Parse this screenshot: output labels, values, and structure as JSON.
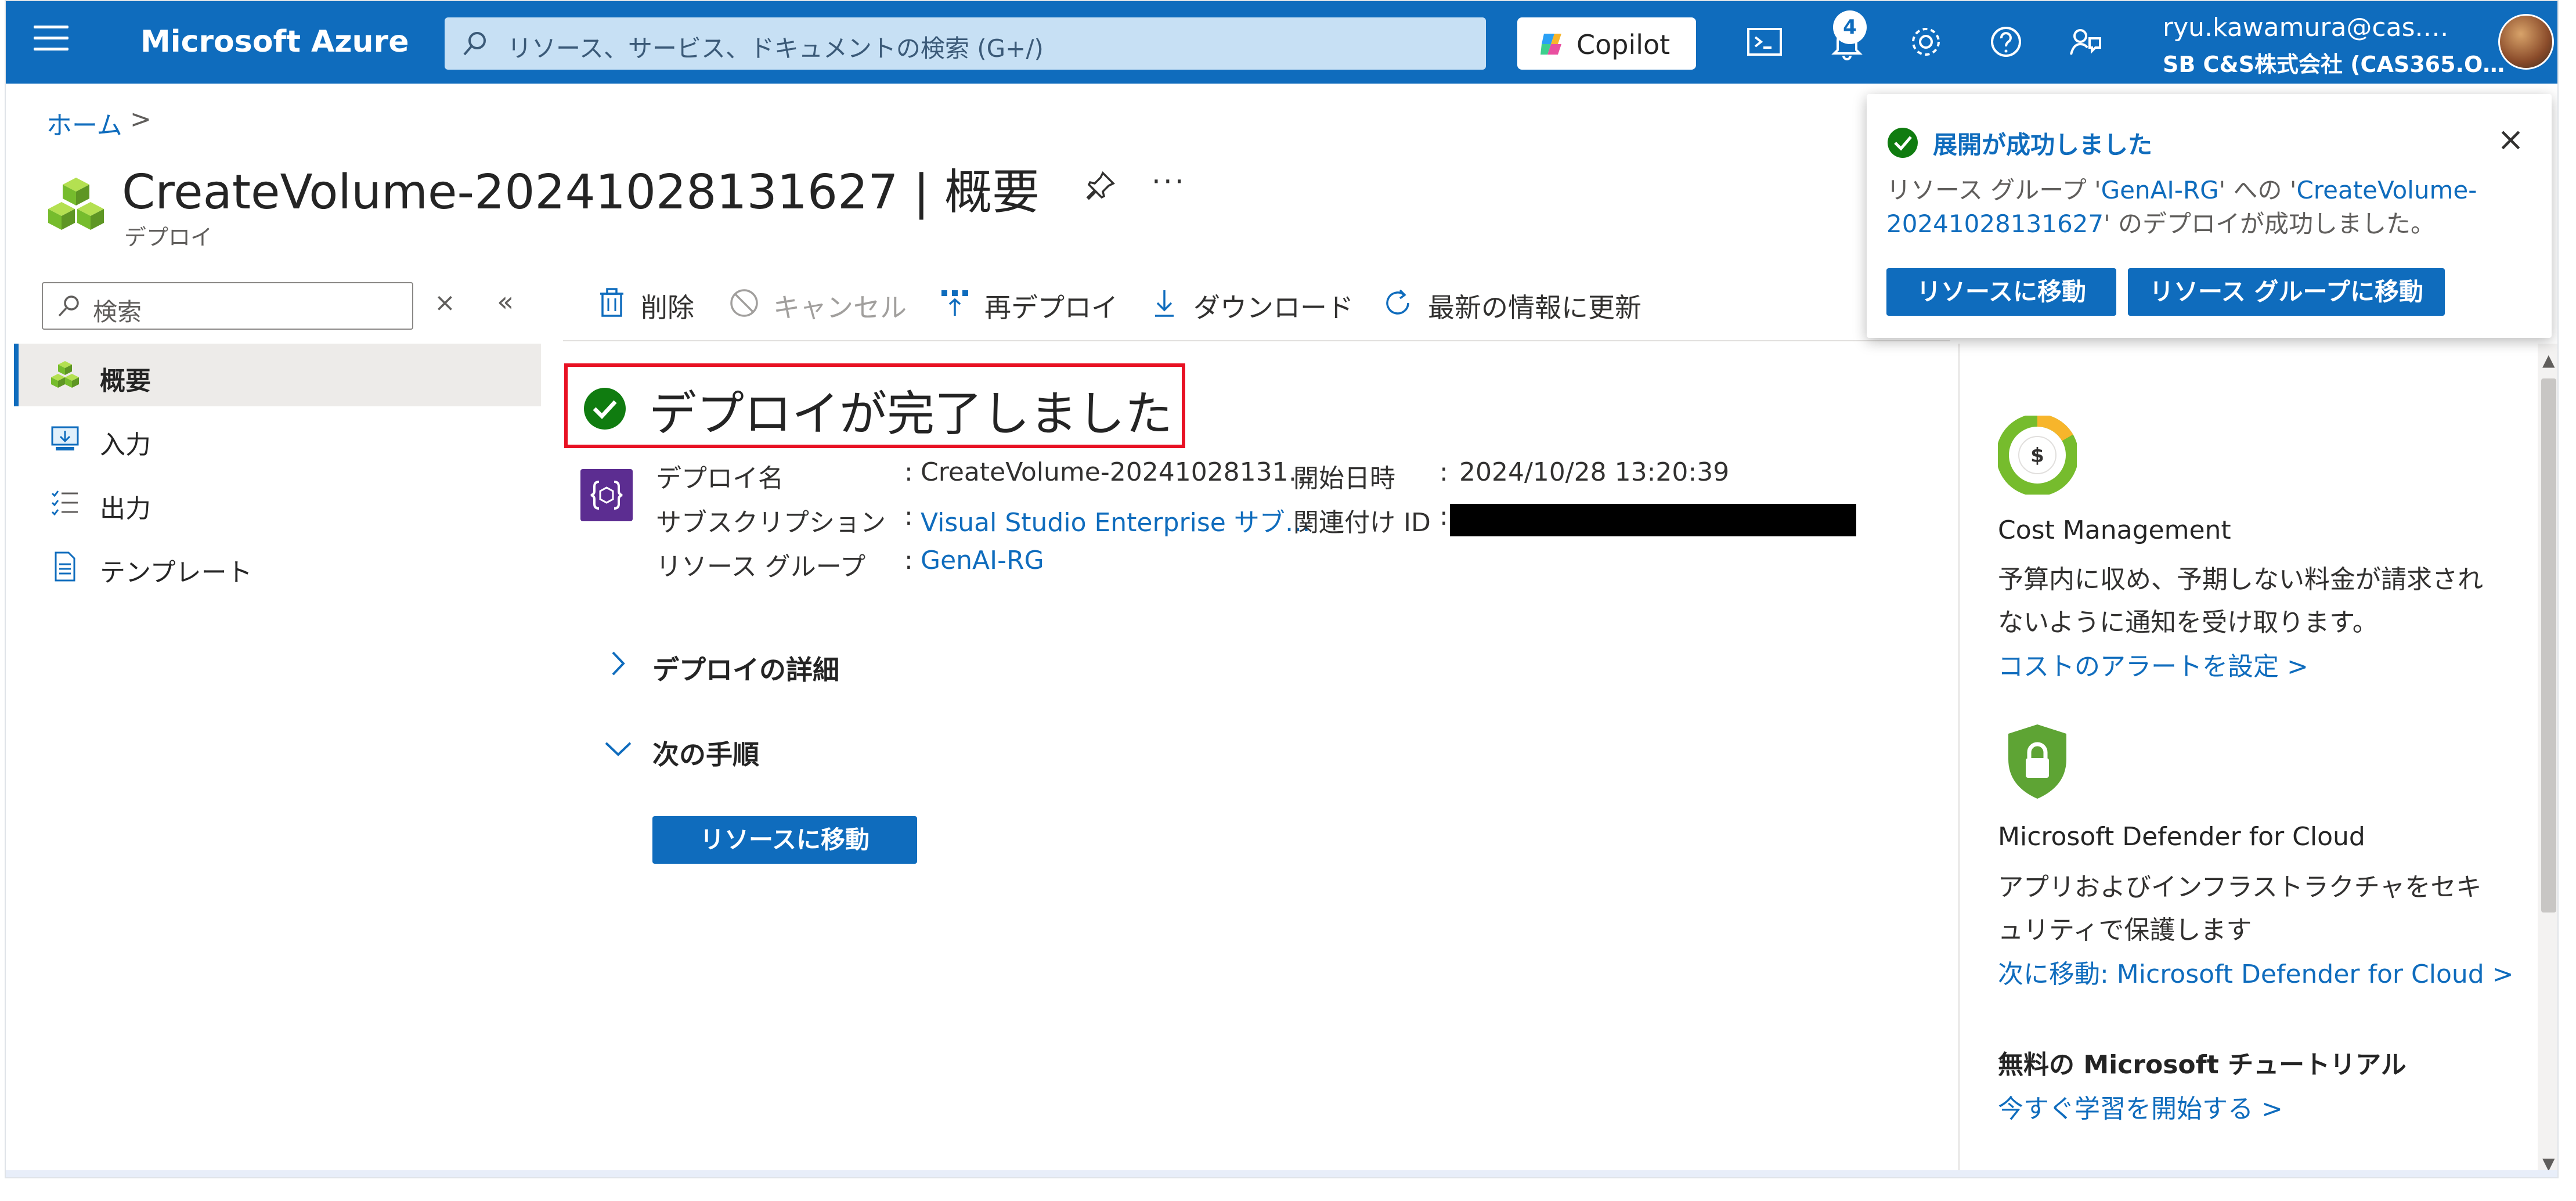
{
  "topbar": {
    "brand": "Microsoft Azure",
    "search_placeholder": "リソース、サービス、ドキュメントの検索 (G+/)",
    "copilot_label": "Copilot",
    "notification_count": "4",
    "user_email": "ryu.kawamura@cas.…",
    "user_tenant": "SB C&S株式会社 (CAS365.O…"
  },
  "breadcrumb": {
    "home": "ホーム",
    "sep": ">"
  },
  "page": {
    "title": "CreateVolume-20241028131627 | 概要",
    "subtitle": "デプロイ",
    "more": "···"
  },
  "leftnav": {
    "search_placeholder": "検索",
    "close_glyph": "×",
    "collapse_glyph": "«",
    "items": [
      {
        "label": "概要",
        "icon": "overview-cubes-icon",
        "active": true
      },
      {
        "label": "入力",
        "icon": "input-icon",
        "active": false
      },
      {
        "label": "出力",
        "icon": "output-list-icon",
        "active": false
      },
      {
        "label": "テンプレート",
        "icon": "template-doc-icon",
        "active": false
      }
    ]
  },
  "toolbar": {
    "delete": "削除",
    "cancel": "キャンセル",
    "redeploy": "再デプロイ",
    "download": "ダウンロード",
    "refresh": "最新の情報に更新"
  },
  "status": {
    "complete_text": "デプロイが完了しました",
    "color_success": "#107c10",
    "color_highlight": "#e81123"
  },
  "details": {
    "name_label": "デプロイ名",
    "name_value": "CreateVolume-20241028131…",
    "subscription_label": "サブスクリプション",
    "subscription_value": "Visual Studio Enterprise サブ…",
    "rg_label": "リソース グループ",
    "rg_value": "GenAI-RG",
    "start_label": "開始日時",
    "start_value": "2024/10/28 13:20:39",
    "corr_label": "関連付け ID",
    "colon": ":"
  },
  "sections": {
    "details_expander": "デプロイの詳細",
    "next_steps": "次の手順",
    "go_to_resource": "リソースに移動"
  },
  "right_panel": {
    "cost_title": "Cost Management",
    "cost_text1": "予算内に収め、予期しない料金が請求され",
    "cost_text2": "ないように通知を受け取ります。",
    "cost_link": "コストのアラートを設定 >",
    "defender_title": "Microsoft Defender for Cloud",
    "defender_text1": "アプリおよびインフラストラクチャをセキ",
    "defender_text2": "ュリティで保護します",
    "defender_link": "次に移動: Microsoft Defender for Cloud >",
    "tutorial_title": "無料の Microsoft チュートリアル",
    "tutorial_link": "今すぐ学習を開始する >"
  },
  "toast": {
    "title": "展開が成功しました",
    "body_prefix": "リソース グループ '",
    "rg_link": "GenAI-RG",
    "body_mid": "' への '",
    "dep_link1": "CreateVolume-",
    "dep_link2": "20241028131627",
    "body_suffix": "' のデプロイが成功しました。",
    "btn_resource": "リソースに移動",
    "btn_rg": "リソース グループに移動",
    "close": "×"
  }
}
